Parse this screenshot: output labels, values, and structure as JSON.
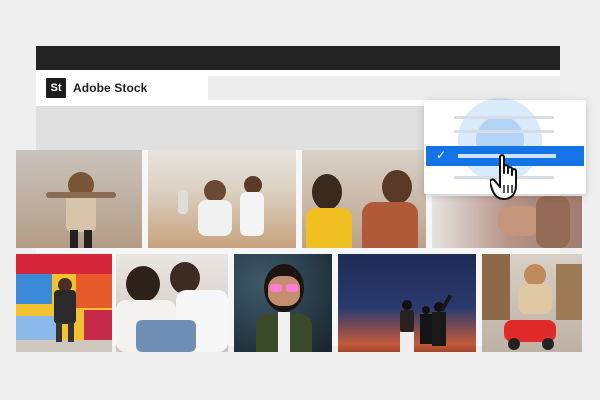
{
  "app": {
    "name": "Adobe Stock",
    "logo_text": "St"
  },
  "dropdown": {
    "selected_check": "✓",
    "accent_color": "#1473e6"
  },
  "cursor": {
    "icon": "hand-pointer-icon"
  },
  "gallery": {
    "photos": [
      {
        "name": "photo-woman-jumping-city",
        "bg": "#b9a99a"
      },
      {
        "name": "photo-family-beach-running",
        "bg": "#c8b59a"
      },
      {
        "name": "photo-two-women-laughing",
        "bg": "#c9b39c"
      },
      {
        "name": "photo-hands-closeup",
        "bg": "#a08878"
      },
      {
        "name": "photo-woman-colorful-wall",
        "bg": "#8aa0c4"
      },
      {
        "name": "photo-couple-embracing",
        "bg": "#8c7d72"
      },
      {
        "name": "photo-woman-neon-glasses",
        "bg": "#2b3b48"
      },
      {
        "name": "photo-family-night-sky",
        "bg": "#1e2a4a"
      },
      {
        "name": "photo-child-red-toy-car",
        "bg": "#c9bfb2"
      }
    ]
  }
}
